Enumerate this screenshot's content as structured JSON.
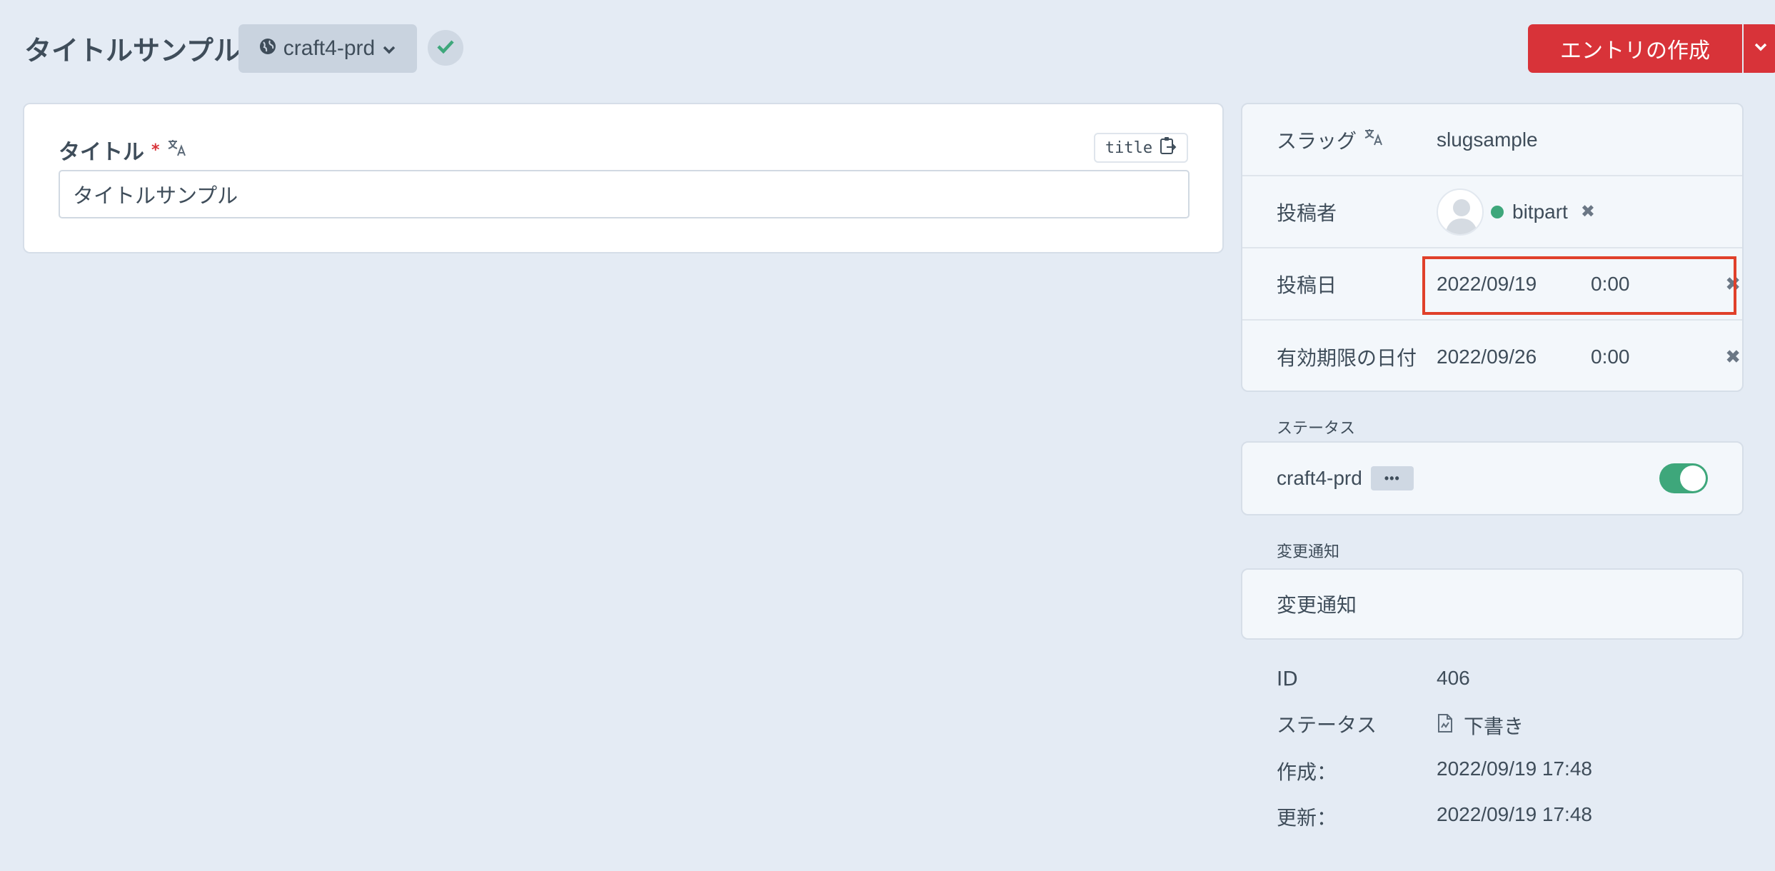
{
  "header": {
    "title": "タイトルサンプル",
    "site": "craft4-prd",
    "create_button": "エントリの作成"
  },
  "title_field": {
    "label": "タイトル",
    "required_mark": "*",
    "handle": "title",
    "value": "タイトルサンプル"
  },
  "meta": {
    "slug_label": "スラッグ",
    "slug_value": "slugsample",
    "author_label": "投稿者",
    "author_name": "bitpart",
    "post_date_label": "投稿日",
    "post_date": "2022/09/19",
    "post_time": "0:00",
    "expiry_label": "有効期限の日付",
    "expiry_date": "2022/09/26",
    "expiry_time": "0:00",
    "clear_icon": "✖"
  },
  "status_section": {
    "heading": "ステータス",
    "site_name": "craft4-prd",
    "more": "•••",
    "enabled": true
  },
  "notify_section": {
    "heading": "変更通知",
    "value": "変更通知"
  },
  "info": {
    "id_label": "ID",
    "id_value": "406",
    "status_label": "ステータス",
    "status_value": "下書き",
    "created_label": "作成：",
    "created_value": "2022/09/19 17:48",
    "updated_label": "更新：",
    "updated_value": "2022/09/19 17:48"
  },
  "colors": {
    "accent_red": "#d83339",
    "highlight": "#e0402a",
    "status_green": "#3ea77b"
  },
  "icons": [
    "globe-icon",
    "chevron-down-icon",
    "check-icon",
    "translate-icon",
    "copy-icon",
    "close-icon",
    "draft-icon"
  ]
}
